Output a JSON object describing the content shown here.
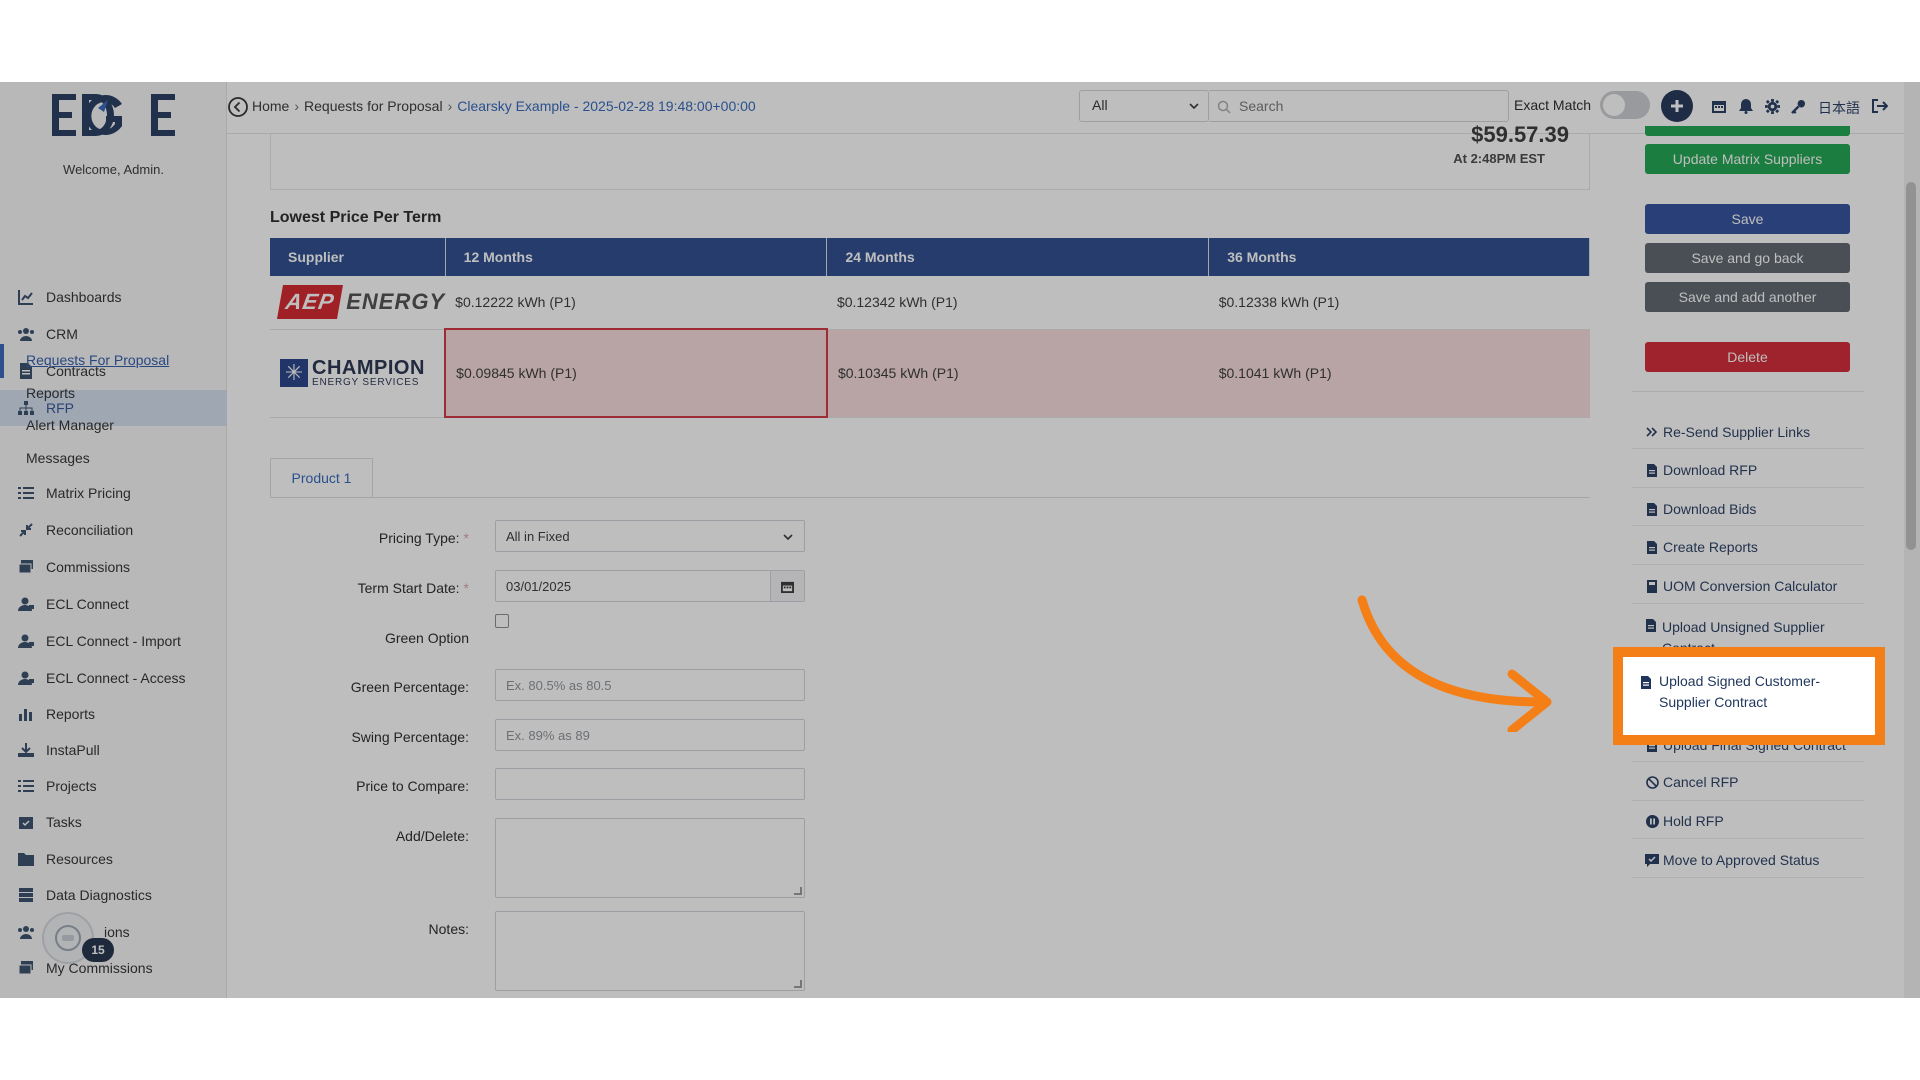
{
  "sidebar": {
    "welcome": "Welcome, Admin.",
    "items": [
      {
        "label": "Dashboards",
        "icon": "chart-line-icon"
      },
      {
        "label": "CRM",
        "icon": "users-icon"
      },
      {
        "label": "Contracts",
        "icon": "file-icon"
      },
      {
        "label": "RFP",
        "icon": "sitemap-icon"
      },
      {
        "label": "Matrix Pricing",
        "icon": "list-icon"
      },
      {
        "label": "Reconciliation",
        "icon": "compress-icon"
      },
      {
        "label": "Commissions",
        "icon": "money-icon"
      },
      {
        "label": "ECL Connect",
        "icon": "user-tie-icon"
      },
      {
        "label": "ECL Connect - Import",
        "icon": "user-tie-icon"
      },
      {
        "label": "ECL Connect - Access",
        "icon": "user-tie-icon"
      },
      {
        "label": "Reports",
        "icon": "bar-chart-icon"
      },
      {
        "label": "InstaPull",
        "icon": "download-icon"
      },
      {
        "label": "Projects",
        "icon": "tasks-icon"
      },
      {
        "label": "Tasks",
        "icon": "calendar-check-icon"
      },
      {
        "label": "Resources",
        "icon": "folder-icon"
      },
      {
        "label": "Data Diagnostics",
        "icon": "database-icon"
      },
      {
        "label": "ions",
        "icon": "users-icon"
      },
      {
        "label": "My Commissions",
        "icon": "money-icon"
      }
    ],
    "rfp_sub": [
      "Requests For Proposal",
      "Reports",
      "Alert Manager",
      "Messages"
    ],
    "chat_count": "15"
  },
  "topbar": {
    "breadcrumb": [
      "Home",
      "Requests for Proposal",
      "Clearsky Example - 2025-02-28 19:48:00+00:00"
    ],
    "scope_value": "All",
    "search_placeholder": "Search",
    "exact_match_label": "Exact Match",
    "exact_match_on": false,
    "language_label": "日本語"
  },
  "price_card": {
    "value": "$59.57.39",
    "time": "At 2:48PM EST"
  },
  "lowest_price": {
    "title": "Lowest Price Per Term",
    "columns": [
      "Supplier",
      "12 Months",
      "24 Months",
      "36 Months"
    ],
    "rows": [
      {
        "supplier_logo": "aep-energy-logo",
        "aep_mark": "AEP",
        "aep_word": "ENERGY",
        "values": [
          "$0.12222 kWh (P1)",
          "$0.12342 kWh (P1)",
          "$0.12338 kWh (P1)"
        ]
      },
      {
        "supplier_logo": "champion-energy-logo",
        "champ_name": "CHAMPION",
        "champ_sub": "ENERGY SERVICES",
        "values": [
          "$0.09845 kWh (P1)",
          "$0.10345 kWh (P1)",
          "$0.1041 kWh (P1)"
        ]
      }
    ]
  },
  "form": {
    "tab_label": "Product 1",
    "pricing_type_label": "Pricing Type:",
    "pricing_type_value": "All in Fixed",
    "term_start_label": "Term Start Date:",
    "term_start_value": "03/01/2025",
    "green_option_label": "Green Option",
    "green_percentage_label": "Green Percentage:",
    "green_percentage_placeholder": "Ex. 80.5% as 80.5",
    "swing_percentage_label": "Swing Percentage:",
    "swing_percentage_placeholder": "Ex. 89% as 89",
    "price_to_compare_label": "Price to Compare:",
    "add_delete_label": "Add/Delete:",
    "notes_label": "Notes:",
    "required_mark": "*"
  },
  "actions": {
    "update_matrix": "Update Matrix Suppliers",
    "save": "Save",
    "save_go_back": "Save and go back",
    "save_add_another": "Save and add another",
    "delete": "Delete",
    "links": [
      "Re-Send Supplier Links",
      "Download RFP",
      "Download Bids",
      "Create Reports",
      "UOM Conversion Calculator",
      "Upload Unsigned Supplier Contract",
      "Upload Signed Customer-Supplier Contract",
      "Upload Final Signed Contract",
      "Cancel RFP",
      "Hold RFP",
      "Move to Approved Status"
    ]
  },
  "colors": {
    "primary": "#24468c",
    "success": "#16a34a",
    "danger": "#d1222f",
    "highlight": "#f57f17"
  }
}
